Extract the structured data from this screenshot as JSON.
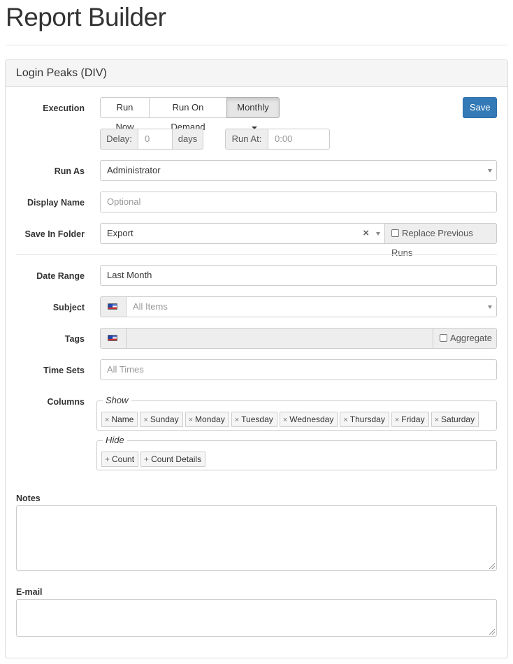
{
  "page": {
    "title": "Report Builder"
  },
  "panel": {
    "heading": "Login Peaks (DIV)"
  },
  "execution": {
    "label": "Execution",
    "options": [
      "Run Now",
      "Run On Demand",
      "Monthly"
    ],
    "selected": "Monthly",
    "save_label": "Save",
    "delay_label": "Delay:",
    "delay_value": "0",
    "delay_unit": "days",
    "run_at_label": "Run At:",
    "run_at_placeholder": "0:00"
  },
  "run_as": {
    "label": "Run As",
    "value": "Administrator"
  },
  "display_name": {
    "label": "Display Name",
    "placeholder": "Optional"
  },
  "save_in_folder": {
    "label": "Save In Folder",
    "value": "Export",
    "clear_glyph": "×",
    "replace_label": "Replace Previous Runs",
    "replace_checked": false
  },
  "date_range": {
    "label": "Date Range",
    "value": "Last Month"
  },
  "subject": {
    "label": "Subject",
    "placeholder": "All Items"
  },
  "tags": {
    "label": "Tags",
    "aggregate_label": "Aggregate",
    "aggregate_checked": false
  },
  "time_sets": {
    "label": "Time Sets",
    "placeholder": "All Times"
  },
  "columns": {
    "label": "Columns",
    "show_legend": "Show",
    "show": [
      "Name",
      "Sunday",
      "Monday",
      "Tuesday",
      "Wednesday",
      "Thursday",
      "Friday",
      "Saturday"
    ],
    "hide_legend": "Hide",
    "hide": [
      "Count",
      "Count Details"
    ],
    "remove_glyph": "×",
    "add_glyph": "+"
  },
  "notes": {
    "label": "Notes",
    "value": ""
  },
  "email": {
    "label": "E-mail",
    "value": ""
  },
  "colors": {
    "primary": "#337ab7",
    "border": "#cccccc",
    "addon_bg": "#eeeeee",
    "panel_heading_bg": "#f5f5f5",
    "placeholder": "#999999"
  },
  "icons": {
    "dropdown": "caret-down-icon",
    "select": "select-arrow-icon",
    "subject_flag": "flag-icon",
    "tags_flag": "flag-icon"
  }
}
